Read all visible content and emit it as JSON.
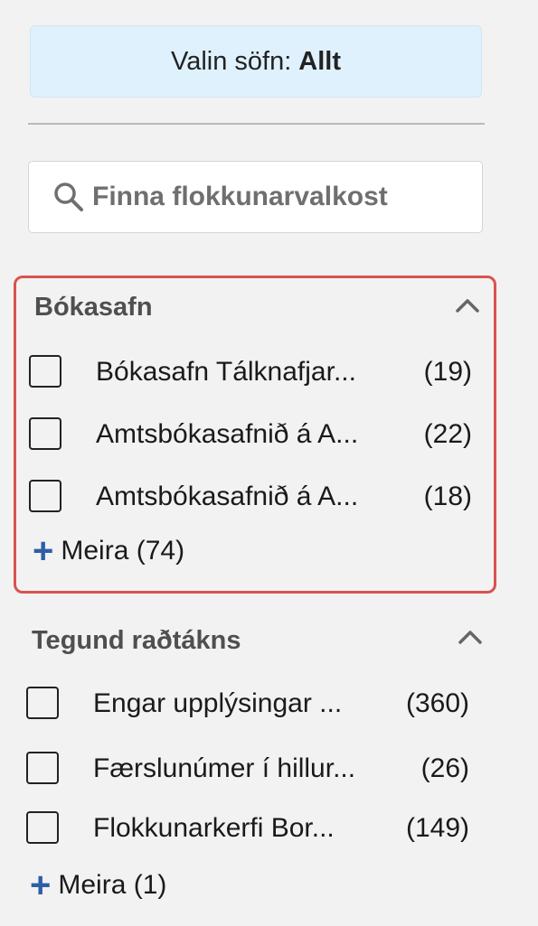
{
  "selected_collections": {
    "label": "Valin söfn:",
    "value": "Allt"
  },
  "search": {
    "placeholder": "Finna flokkunarvalkost",
    "icon": "search-icon"
  },
  "facets": [
    {
      "title": "Bókasafn",
      "expanded": true,
      "highlighted": true,
      "options": [
        {
          "label": "Bókasafn Tálknafjar...",
          "count": "(19)",
          "checked": false
        },
        {
          "label": "Amtsbókasafnið á A...",
          "count": "(22)",
          "checked": false
        },
        {
          "label": "Amtsbókasafnið á A...",
          "count": "(18)",
          "checked": false
        }
      ],
      "more_label": "Meira (74)"
    },
    {
      "title": "Tegund raðtákns",
      "expanded": true,
      "highlighted": false,
      "options": [
        {
          "label": "Engar upplýsingar ...",
          "count": "(360)",
          "checked": false
        },
        {
          "label": "Færslunúmer í hillur...",
          "count": "(26)",
          "checked": false
        },
        {
          "label": "Flokkunarkerfi Bor...",
          "count": "(149)",
          "checked": false
        }
      ],
      "more_label": "Meira (1)"
    }
  ],
  "colors": {
    "background": "#f2f2f2",
    "selected_box": "#dff1fc",
    "highlight_border": "#d9534f",
    "plus_accent": "#2f5ea8"
  }
}
